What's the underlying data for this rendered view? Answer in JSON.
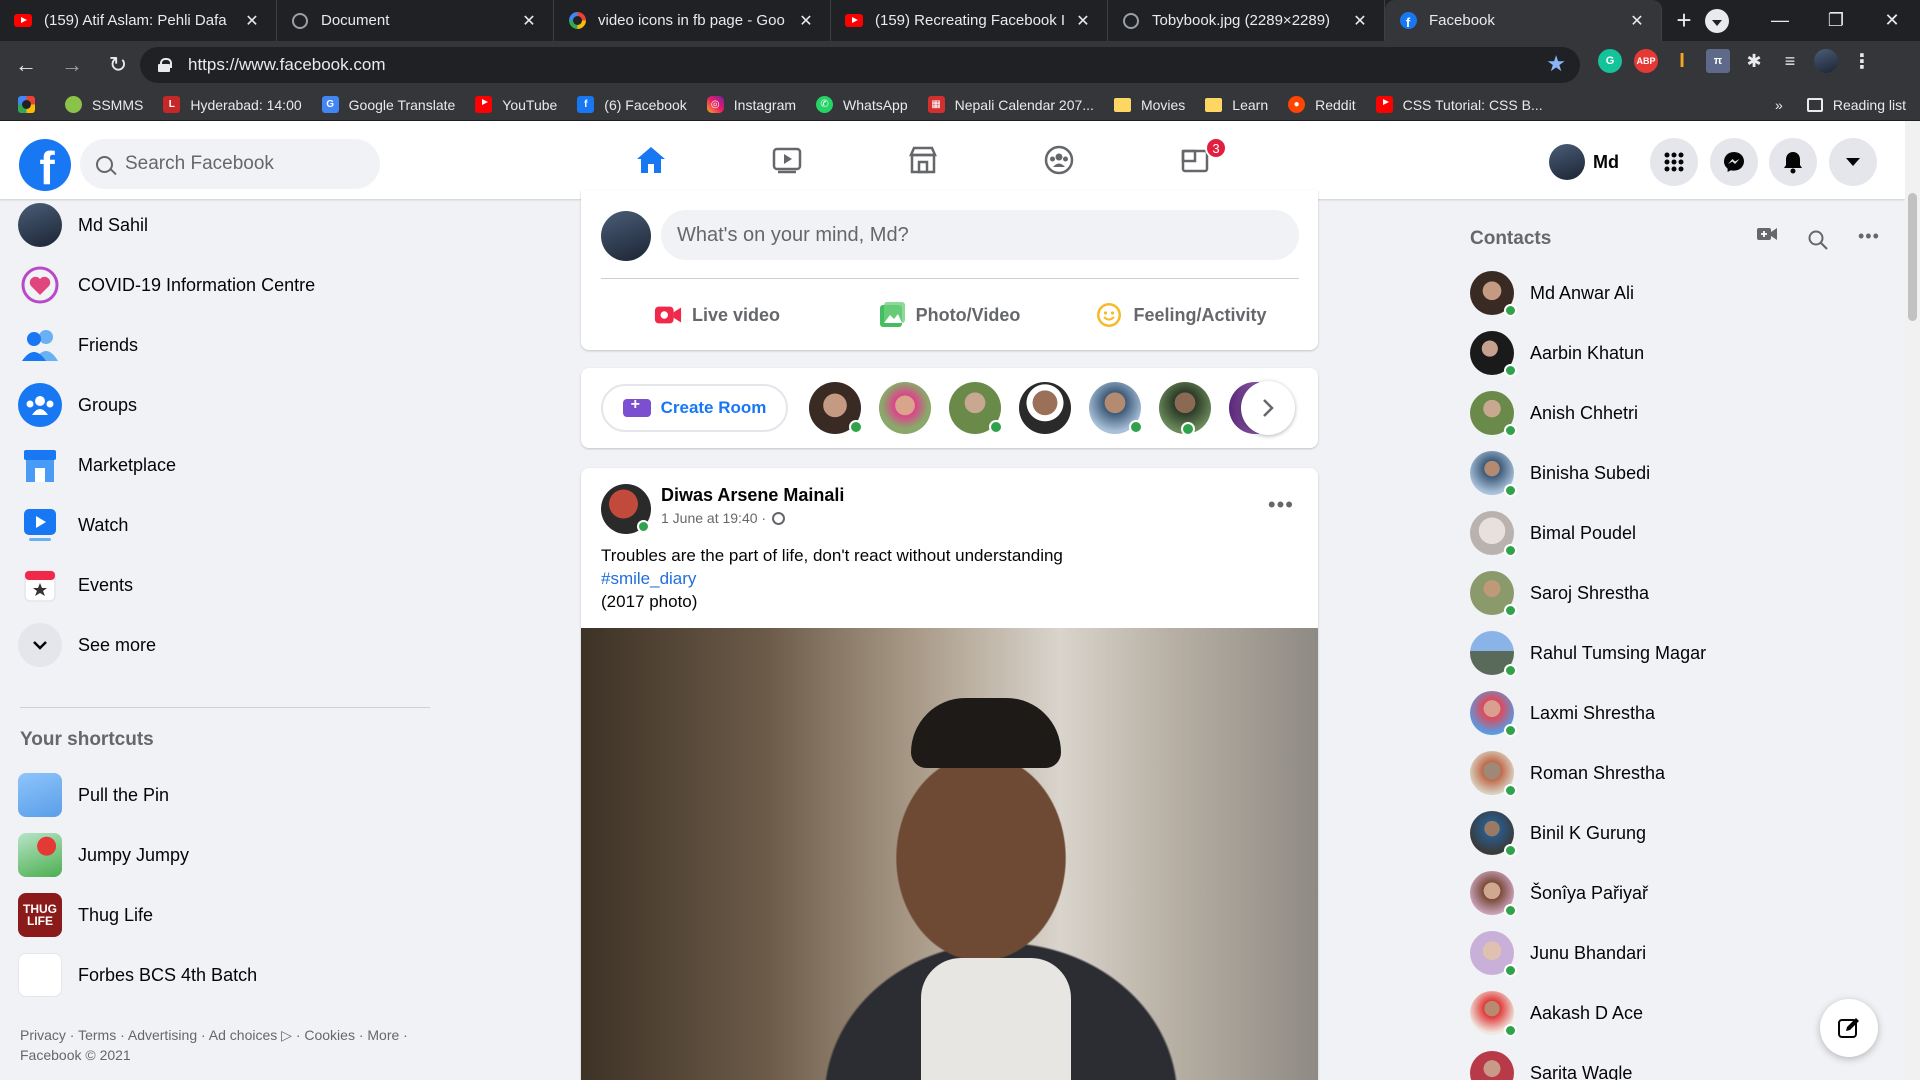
{
  "browser": {
    "tabs": [
      {
        "title": "(159) Atif Aslam: Pehli Dafa",
        "icon": "youtube-icon"
      },
      {
        "title": "Document",
        "icon": "globe-icon"
      },
      {
        "title": "video icons in fb page - Goo",
        "icon": "google-icon"
      },
      {
        "title": "(159) Recreating Facebook I",
        "icon": "youtube-icon"
      },
      {
        "title": "Tobybook.jpg (2289×2289)",
        "icon": "globe-icon"
      },
      {
        "title": "Facebook",
        "icon": "facebook-icon",
        "active": true
      }
    ],
    "url": "https://www.facebook.com",
    "bookmarks": [
      {
        "label": "",
        "icon": "google-icon"
      },
      {
        "label": "SSMMS",
        "icon": "site-icon"
      },
      {
        "label": "Hyderabad: 14:00",
        "icon": "clock-site-icon"
      },
      {
        "label": "Google Translate",
        "icon": "translate-icon"
      },
      {
        "label": "YouTube",
        "icon": "youtube-icon"
      },
      {
        "label": "(6) Facebook",
        "icon": "facebook-icon"
      },
      {
        "label": "Instagram",
        "icon": "instagram-icon"
      },
      {
        "label": "WhatsApp",
        "icon": "whatsapp-icon"
      },
      {
        "label": "Nepali Calendar 207...",
        "icon": "calendar-site-icon"
      },
      {
        "label": "Movies",
        "icon": "folder-icon"
      },
      {
        "label": "Learn",
        "icon": "folder-icon"
      },
      {
        "label": "Reddit",
        "icon": "reddit-icon"
      },
      {
        "label": "CSS Tutorial: CSS B...",
        "icon": "youtube-icon"
      }
    ],
    "more_bookmarks": "»",
    "reading_list": "Reading list"
  },
  "header": {
    "search_placeholder": "Search Facebook",
    "profile_name": "Md",
    "gaming_badge": "3"
  },
  "left_sidebar": {
    "items": [
      {
        "label": "Md Sahil",
        "icon": "profile-avatar"
      },
      {
        "label": "COVID-19 Information Centre",
        "icon": "covid-heart-icon"
      },
      {
        "label": "Friends",
        "icon": "friends-icon"
      },
      {
        "label": "Groups",
        "icon": "groups-icon"
      },
      {
        "label": "Marketplace",
        "icon": "marketplace-icon"
      },
      {
        "label": "Watch",
        "icon": "watch-icon"
      },
      {
        "label": "Events",
        "icon": "events-icon"
      },
      {
        "label": "See more",
        "icon": "chevron-down-icon"
      }
    ],
    "shortcuts_heading": "Your shortcuts",
    "shortcuts": [
      {
        "label": "Pull the Pin"
      },
      {
        "label": "Jumpy Jumpy"
      },
      {
        "label": "Thug Life"
      },
      {
        "label": "Forbes BCS 4th Batch"
      }
    ],
    "footer_line1": "Privacy · Terms · Advertising · Ad choices ▷ · Cookies · More ·",
    "footer_line2": "Facebook © 2021"
  },
  "composer": {
    "placeholder": "What's on your mind, Md?",
    "live_video": "Live video",
    "photo_video": "Photo/Video",
    "feeling": "Feeling/Activity"
  },
  "rooms": {
    "create_room": "Create Room"
  },
  "post": {
    "author": "Diwas Arsene Mainali",
    "time": "1 June at 19:40 ·",
    "text_line1": "Troubles are the part of life, don't react without understanding",
    "hashtag": "#smile_diary",
    "text_line3": "(2017 photo)"
  },
  "contacts": {
    "heading": "Contacts",
    "list": [
      "Md Anwar Ali",
      "Aarbin Khatun",
      "Anish Chhetri",
      "Binisha Subedi",
      "Bimal Poudel",
      "Saroj Shrestha",
      "Rahul Tumsing Magar",
      "Laxmi Shrestha",
      "Roman Shrestha",
      "Binil K Gurung",
      "Šonîya Pařiyař",
      "Junu Bhandari",
      "Aakash D Ace",
      "Sarita Wagle"
    ]
  },
  "colors": {
    "brand": "#1877f2",
    "online": "#31a24c",
    "badge": "#e41e3f",
    "live_red": "#f02849",
    "photo_green": "#45bd62",
    "feeling_yellow": "#f7b928"
  }
}
